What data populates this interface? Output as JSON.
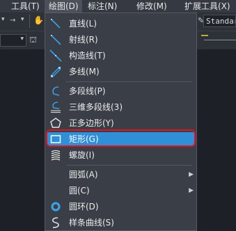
{
  "menubar": {
    "items": [
      "工具(T)",
      "绘图(D)",
      "标注(N)",
      "修改(M)",
      "扩展工具(X)"
    ],
    "active": "绘图(D)"
  },
  "toolbar": {
    "text_style": "Standar"
  },
  "draw_menu": {
    "items": [
      {
        "label": "直线(L)",
        "icon": "line-icon",
        "submenu": false
      },
      {
        "label": "射线(R)",
        "icon": "ray-icon",
        "submenu": false
      },
      {
        "label": "构造线(T)",
        "icon": "construction-line-icon",
        "submenu": false
      },
      {
        "label": "多线(M)",
        "icon": "multiline-icon",
        "submenu": false
      },
      {
        "label": "多段线(P)",
        "icon": "polyline-icon",
        "submenu": false
      },
      {
        "label": "三维多段线(3)",
        "icon": "3d-polyline-icon",
        "submenu": false
      },
      {
        "label": "正多边形(Y)",
        "icon": "polygon-icon",
        "submenu": false
      },
      {
        "label": "矩形(G)",
        "icon": "rectangle-icon",
        "submenu": false,
        "highlighted": true
      },
      {
        "label": "螺旋(I)",
        "icon": "helix-icon",
        "submenu": false
      },
      {
        "label": "圆弧(A)",
        "icon": "",
        "submenu": true
      },
      {
        "label": "圆(C)",
        "icon": "",
        "submenu": true
      },
      {
        "label": "圆环(D)",
        "icon": "donut-icon",
        "submenu": false
      },
      {
        "label": "样条曲线(S)",
        "icon": "spline-icon",
        "submenu": false
      }
    ]
  },
  "colors": {
    "highlight": "#2f8fd8",
    "annotation_box": "#e0141e",
    "icon_blue": "#3aa0e8",
    "menu_bg": "#3a3e46"
  }
}
